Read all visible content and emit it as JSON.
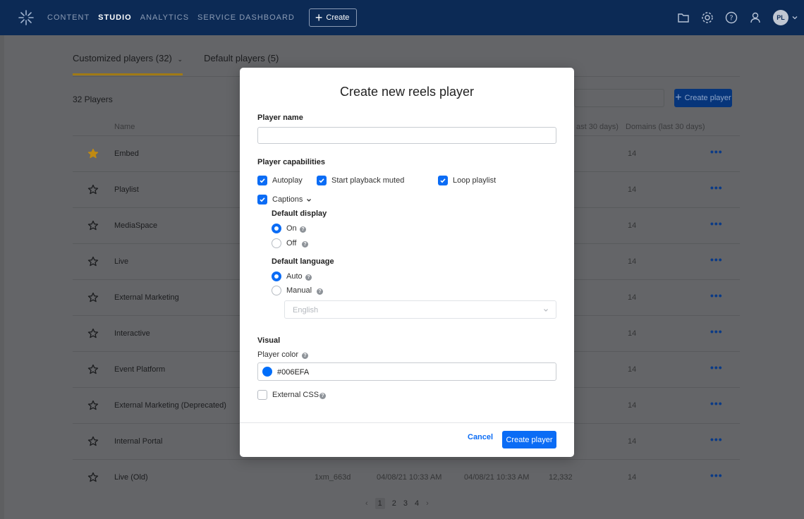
{
  "topbar": {
    "nav": [
      "CONTENT",
      "STUDIO",
      "ANALYTICS",
      "SERVICE DASHBOARD"
    ],
    "active_nav": "STUDIO",
    "create_label": "Create",
    "avatar_initials": "PL"
  },
  "page": {
    "tabs": [
      "Customized players (32)",
      "Default players (5)"
    ],
    "players_count": "32 Players",
    "create_player_label": "Create player",
    "columns": {
      "name": "Name",
      "visible_part": "ast 30 days)",
      "domains": "Domains (last 30 days)"
    },
    "rows": [
      {
        "name": "Embed",
        "domains": "14",
        "starred": true
      },
      {
        "name": "Playlist",
        "domains": "14",
        "starred": false
      },
      {
        "name": "MediaSpace",
        "domains": "14",
        "starred": false
      },
      {
        "name": "Live",
        "domains": "14",
        "starred": false
      },
      {
        "name": "External Marketing",
        "domains": "14",
        "starred": false
      },
      {
        "name": "Interactive",
        "domains": "14",
        "starred": false
      },
      {
        "name": "Event Platform",
        "domains": "14",
        "starred": false
      },
      {
        "name": "External Marketing (Deprecated)",
        "domains": "14",
        "starred": false
      },
      {
        "name": "Internal Portal",
        "domains": "14",
        "starred": false
      },
      {
        "name": "Live (Old)",
        "domains": "14",
        "starred": false,
        "id": "1xm_663d",
        "created": "04/08/21 10:33 AM",
        "updated": "04/08/21 10:33 AM",
        "plays": "12,332"
      }
    ],
    "more_label": "•••",
    "pagination": {
      "prev": "‹",
      "pages": [
        "1",
        "2",
        "3",
        "4"
      ],
      "current": "1",
      "next": "›"
    }
  },
  "modal": {
    "title": "Create new reels player",
    "player_name_label": "Player name",
    "player_name_value": "",
    "capabilities_label": "Player capabilities",
    "autoplay": "Autoplay",
    "start_muted": "Start playback muted",
    "loop": "Loop playlist",
    "captions": "Captions",
    "default_display": "Default display",
    "on": "On",
    "off": "Off",
    "default_language": "Default language",
    "auto": "Auto",
    "manual": "Manual",
    "language_select": "English",
    "visual": "Visual",
    "player_color_label": "Player color",
    "player_color_value": "#006EFA",
    "external_css": "External CSS",
    "help_glyph": "?",
    "cancel": "Cancel",
    "create": "Create player"
  },
  "colors": {
    "accent": "#0b6cf5",
    "topbar": "#0c2a55",
    "player_color": "#006EFA"
  }
}
